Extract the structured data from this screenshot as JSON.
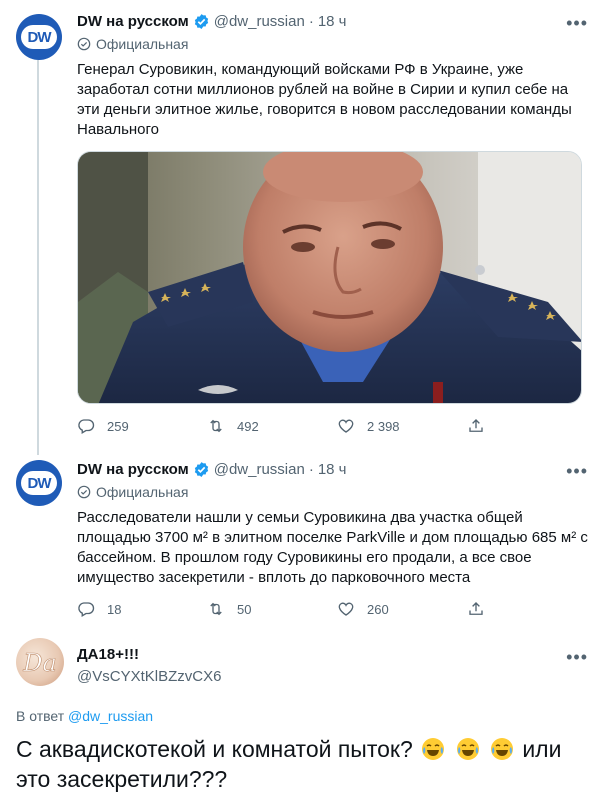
{
  "tweets": [
    {
      "author": "DW на русском",
      "handle": "@dw_russian",
      "separator": "·",
      "time": "18 ч",
      "badge": "Официальная",
      "avatar_text": "DW",
      "text": "Генерал Суровикин, командующий войсками РФ в Украине, уже заработал сотни миллионов рублей на войне в Сирии и купил себе на эти деньги элитное жилье, говорится в новом расследовании команды Навального",
      "replies": "259",
      "retweets": "492",
      "likes": "2 398"
    },
    {
      "author": "DW на русском",
      "handle": "@dw_russian",
      "separator": "·",
      "time": "18 ч",
      "badge": "Официальная",
      "avatar_text": "DW",
      "text": "Расследователи нашли у семьи Суровикина два участка общей площадью 3700 м² в элитном поселке ParkVille и дом площадью 685 м² с бассейном. В прошлом году Суровикины его продали, а все свое имущество засекретили - вплоть до парковочного места",
      "replies": "18",
      "retweets": "50",
      "likes": "260"
    }
  ],
  "reply": {
    "author": "ДА18+!!!",
    "handle": "@VsCYXtKlBZzvCX6",
    "in_reply_prefix": "В ответ",
    "in_reply_handle": "@dw_russian",
    "text_part1": "С аквадискотекой и комнатой пыток?",
    "text_part2": " или это  засекретили???",
    "emoji": "face-with-tears-of-joy"
  },
  "colors": {
    "accent": "#1d9bf0",
    "secondary_text": "#536471",
    "dw_blue": "#1f5bb7",
    "verified_blue": "#1d9bf0"
  },
  "icons": [
    "verified-badge-icon",
    "official-label-icon",
    "more-icon",
    "reply-icon",
    "retweet-icon",
    "like-icon",
    "share-icon",
    "laugh-emoji-icon"
  ]
}
